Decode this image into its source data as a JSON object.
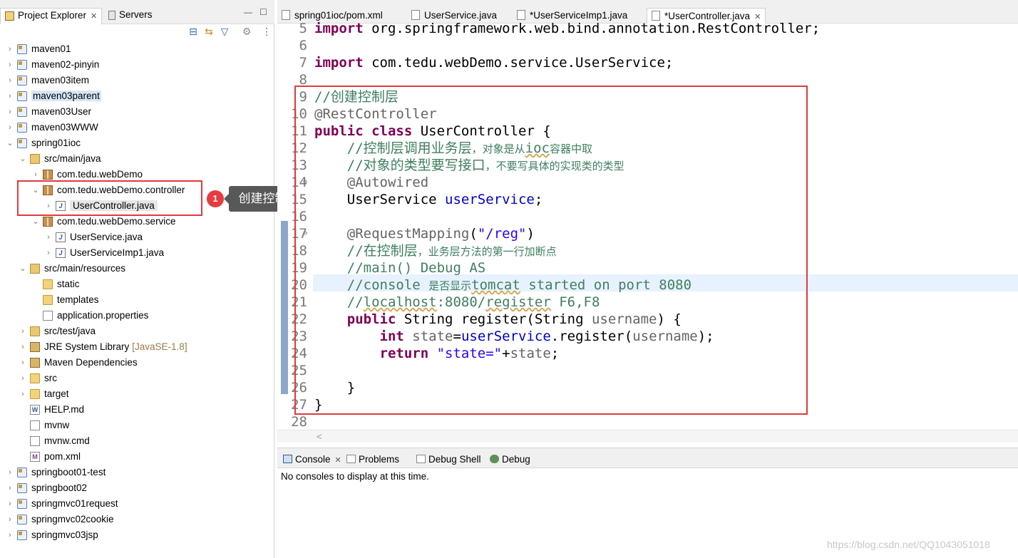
{
  "explorer": {
    "tab_project": "Project Explorer",
    "tab_servers": "Servers",
    "tab_close": "✕",
    "minimize": "—",
    "maximize": "☐",
    "toolbar_icons": [
      "collapse-all-icon",
      "link-with-editor-icon",
      "filter-icon",
      "view-menu-icon",
      "more-icon"
    ],
    "tree": [
      {
        "label": "maven01",
        "icon": "project",
        "depth": 0,
        "twisty": "›"
      },
      {
        "label": "maven02-pinyin",
        "icon": "project",
        "depth": 0,
        "twisty": "›"
      },
      {
        "label": "maven03item",
        "icon": "project",
        "depth": 0,
        "twisty": "›"
      },
      {
        "label": "maven03parent",
        "icon": "project",
        "depth": 0,
        "twisty": "›",
        "highlight": true
      },
      {
        "label": "maven03User",
        "icon": "project",
        "depth": 0,
        "twisty": "›"
      },
      {
        "label": "maven03WWW",
        "icon": "project",
        "depth": 0,
        "twisty": "›"
      },
      {
        "label": "spring01ioc",
        "icon": "project",
        "depth": 0,
        "twisty": "⌄"
      },
      {
        "label": "src/main/java",
        "icon": "srcfolder",
        "depth": 1,
        "twisty": "⌄"
      },
      {
        "label": "com.tedu.webDemo",
        "icon": "package",
        "depth": 2,
        "twisty": "›"
      },
      {
        "label": "com.tedu.webDemo.controller",
        "icon": "package",
        "depth": 2,
        "twisty": "⌄"
      },
      {
        "label": "UserController.java",
        "icon": "java",
        "depth": 3,
        "twisty": "›",
        "selected": true
      },
      {
        "label": "com.tedu.webDemo.service",
        "icon": "package",
        "depth": 2,
        "twisty": "⌄"
      },
      {
        "label": "UserService.java",
        "icon": "java",
        "depth": 3,
        "twisty": "›"
      },
      {
        "label": "UserServiceImp1.java",
        "icon": "java",
        "depth": 3,
        "twisty": "›"
      },
      {
        "label": "src/main/resources",
        "icon": "srcfolder",
        "depth": 1,
        "twisty": "⌄"
      },
      {
        "label": "static",
        "icon": "folder",
        "depth": 2,
        "twisty": ""
      },
      {
        "label": "templates",
        "icon": "folder",
        "depth": 2,
        "twisty": ""
      },
      {
        "label": "application.properties",
        "icon": "file",
        "depth": 2,
        "twisty": ""
      },
      {
        "label": "src/test/java",
        "icon": "srcfolder",
        "depth": 1,
        "twisty": "›"
      },
      {
        "label": "JRE System Library",
        "suffix": "[JavaSE-1.8]",
        "icon": "library",
        "depth": 1,
        "twisty": "›"
      },
      {
        "label": "Maven Dependencies",
        "icon": "library",
        "depth": 1,
        "twisty": "›"
      },
      {
        "label": "src",
        "icon": "folder",
        "depth": 1,
        "twisty": "›"
      },
      {
        "label": "target",
        "icon": "folder",
        "depth": 1,
        "twisty": "›"
      },
      {
        "label": "HELP.md",
        "icon": "md",
        "depth": 1,
        "twisty": ""
      },
      {
        "label": "mvnw",
        "icon": "file",
        "depth": 1,
        "twisty": ""
      },
      {
        "label": "mvnw.cmd",
        "icon": "file",
        "depth": 1,
        "twisty": ""
      },
      {
        "label": "pom.xml",
        "icon": "xml",
        "depth": 1,
        "twisty": ""
      },
      {
        "label": "springboot01-test",
        "icon": "project",
        "depth": 0,
        "twisty": "›"
      },
      {
        "label": "springboot02",
        "icon": "project",
        "depth": 0,
        "twisty": "›"
      },
      {
        "label": "springmvc01request",
        "icon": "project",
        "depth": 0,
        "twisty": "›"
      },
      {
        "label": "springmvc02cookie",
        "icon": "project",
        "depth": 0,
        "twisty": "›"
      },
      {
        "label": "springmvc03jsp",
        "icon": "project",
        "depth": 0,
        "twisty": "›"
      }
    ],
    "callout_number": "1",
    "callout_text": "创建控制层"
  },
  "editor": {
    "tabs": [
      {
        "label": "spring01ioc/pom.xml",
        "active": false
      },
      {
        "label": "UserService.java",
        "active": false
      },
      {
        "label": "*UserServiceImp1.java",
        "active": false
      },
      {
        "label": "*UserController.java",
        "active": true
      }
    ],
    "tab_close": "✕",
    "code_lines": [
      {
        "n": "5",
        "html": "<span class='kw'>import</span> org.springframework.web.bind.annotation.RestController;"
      },
      {
        "n": "6",
        "html": ""
      },
      {
        "n": "7",
        "html": "<span class='kw'>import</span> com.tedu.webDemo.service.UserService;"
      },
      {
        "n": "8",
        "html": ""
      },
      {
        "n": "9",
        "html": "<span class='cm'>//创建控制层</span>"
      },
      {
        "n": "10",
        "html": "<span class='an'>@RestController</span>"
      },
      {
        "n": "11",
        "html": "<span class='kw'>public</span> <span class='kw'>class</span> UserController {"
      },
      {
        "n": "12",
        "html": "    <span class='cm'>//控制层调用业务层<span class='cj'>，对象是从</span><span class='sq'>ioc</span><span class='cj'>容器中取</span></span>"
      },
      {
        "n": "13",
        "html": "    <span class='cm'>//对象的类型要写接口<span class='cj'>，不要写具体的实现类的类型</span></span>"
      },
      {
        "n": "14",
        "html": "    <span class='an'>@Autowired</span>",
        "fold": true
      },
      {
        "n": "15",
        "html": "    UserService <span class='fld'>userService</span>;"
      },
      {
        "n": "16",
        "html": ""
      },
      {
        "n": "17",
        "html": "    <span class='an'>@RequestMapping</span>(<span class='st'>\"/reg\"</span>)",
        "fold": true
      },
      {
        "n": "18",
        "html": "    <span class='cm'>//在控制层<span class='cj'>，业务层方法的第一行加断点</span></span>"
      },
      {
        "n": "19",
        "html": "    <span class='cm'>//main() Debug AS</span>"
      },
      {
        "n": "20",
        "html": "    <span class='cm'>//console <span class='cj'>是否显示</span><span class='sq'>tomcat</span> started on port 8080</span>"
      },
      {
        "n": "21",
        "html": "    <span class='cm'>//<span class='sq'>localhost</span>:8080/<span class='sq'>register</span> F6,F8</span>"
      },
      {
        "n": "22",
        "html": "    <span class='kw'>public</span> String register(String <span class='an'>username</span>) {"
      },
      {
        "n": "23",
        "html": "        <span class='kw'>int</span> <span class='an'>state</span>=<span class='fld'>userService</span>.register(<span class='an'>username</span>);"
      },
      {
        "n": "24",
        "html": "        <span class='kw'>return</span> <span class='st'>\"state=\"</span>+<span class='an'>state</span>;"
      },
      {
        "n": "25",
        "html": ""
      },
      {
        "n": "26",
        "html": "    }"
      },
      {
        "n": "27",
        "html": "}"
      },
      {
        "n": "28",
        "html": ""
      }
    ],
    "scroll_left": "<"
  },
  "console": {
    "tabs": [
      "Console",
      "Problems",
      "Debug Shell",
      "Debug"
    ],
    "tab_close": "✕",
    "message": "No consoles to display at this time."
  },
  "watermark": "https://blog.csdn.net/QQ1043051018",
  "colors": {
    "accent_red": "#e0393e",
    "keyword": "#7f0055",
    "comment": "#3f7f5f",
    "string": "#2a00ff",
    "field": "#0000c0"
  }
}
